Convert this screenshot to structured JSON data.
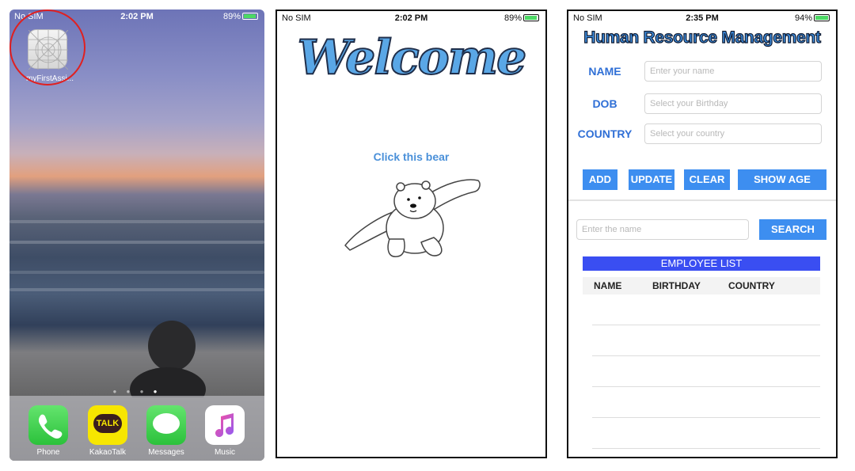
{
  "home": {
    "status": {
      "carrier": "No SIM",
      "time": "2:02 PM",
      "battery": "89%"
    },
    "app_label": "myFirstAssi...",
    "dock": [
      {
        "label": "Phone",
        "icon": "phone-icon"
      },
      {
        "label": "KakaoTalk",
        "icon": "kakaotalk-icon",
        "badge_text": "TALK"
      },
      {
        "label": "Messages",
        "icon": "messages-icon"
      },
      {
        "label": "Music",
        "icon": "music-icon"
      }
    ],
    "colors": {
      "highlight_ring": "#e02020"
    }
  },
  "welcome": {
    "status": {
      "carrier": "No SIM",
      "time": "2:02 PM",
      "battery": "89%"
    },
    "title": "Welcome",
    "click_text": "Click this bear"
  },
  "hrm": {
    "status": {
      "carrier": "No SIM",
      "time": "2:35 PM",
      "battery": "94%"
    },
    "title": "Human Resource Management",
    "fields": [
      {
        "label": "NAME",
        "placeholder": "Enter your name"
      },
      {
        "label": "DOB",
        "placeholder": "Select your Birthday"
      },
      {
        "label": "COUNTRY",
        "placeholder": "Select your country"
      }
    ],
    "buttons": {
      "add": "ADD",
      "update": "UPDATE",
      "clear": "CLEAR",
      "show_age": "SHOW AGE"
    },
    "search": {
      "placeholder": "Enter the name",
      "button": "SEARCH"
    },
    "list": {
      "title": "EMPLOYEE LIST",
      "columns": [
        "NAME",
        "BIRTHDAY",
        "COUNTRY"
      ]
    },
    "colors": {
      "accent": "#3d8ef0",
      "list_header": "#3a4ef2",
      "label": "#2f6fd6"
    }
  }
}
